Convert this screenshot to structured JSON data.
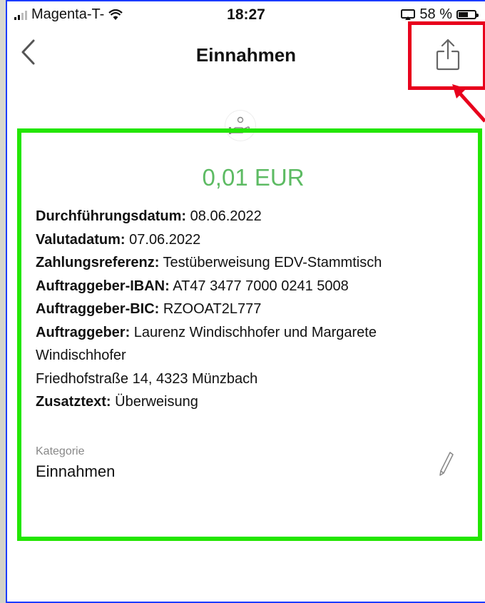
{
  "status_bar": {
    "carrier": "Magenta-T-",
    "time": "18:27",
    "battery": "58 %"
  },
  "nav": {
    "back_icon": "chevron-left-icon",
    "title": "Einnahmen",
    "share_icon": "share-icon"
  },
  "transaction": {
    "amount": "0,01 EUR",
    "amount_color": "#5dbb63",
    "fields": [
      {
        "label": "Durchführungsdatum:",
        "value": " 08.06.2022"
      },
      {
        "label": "Valutadatum:",
        "value": " 07.06.2022"
      },
      {
        "label": "Zahlungsreferenz:",
        "value": " Testüberweisung EDV-Stammtisch"
      },
      {
        "label": "Auftraggeber-IBAN:",
        "value": " AT47 3477 7000 0241 5008"
      },
      {
        "label": "Auftraggeber-BIC:",
        "value": " RZOOAT2L777"
      },
      {
        "label": "Auftraggeber:",
        "value": " Laurenz Windischhofer und Margarete"
      }
    ],
    "continuation_lines": [
      "Windischhofer",
      "Friedhofstraße 14, 4323 Münzbach"
    ],
    "extra": {
      "label": "Zusatztext:",
      "value": " Überweisung"
    }
  },
  "category": {
    "label": "Kategorie",
    "value": "Einnahmen",
    "edit_icon": "pencil-icon"
  },
  "annotations": {
    "highlight_red": "#e8001c",
    "highlight_green": "#22e600",
    "frame_blue": "#1b3cff"
  }
}
